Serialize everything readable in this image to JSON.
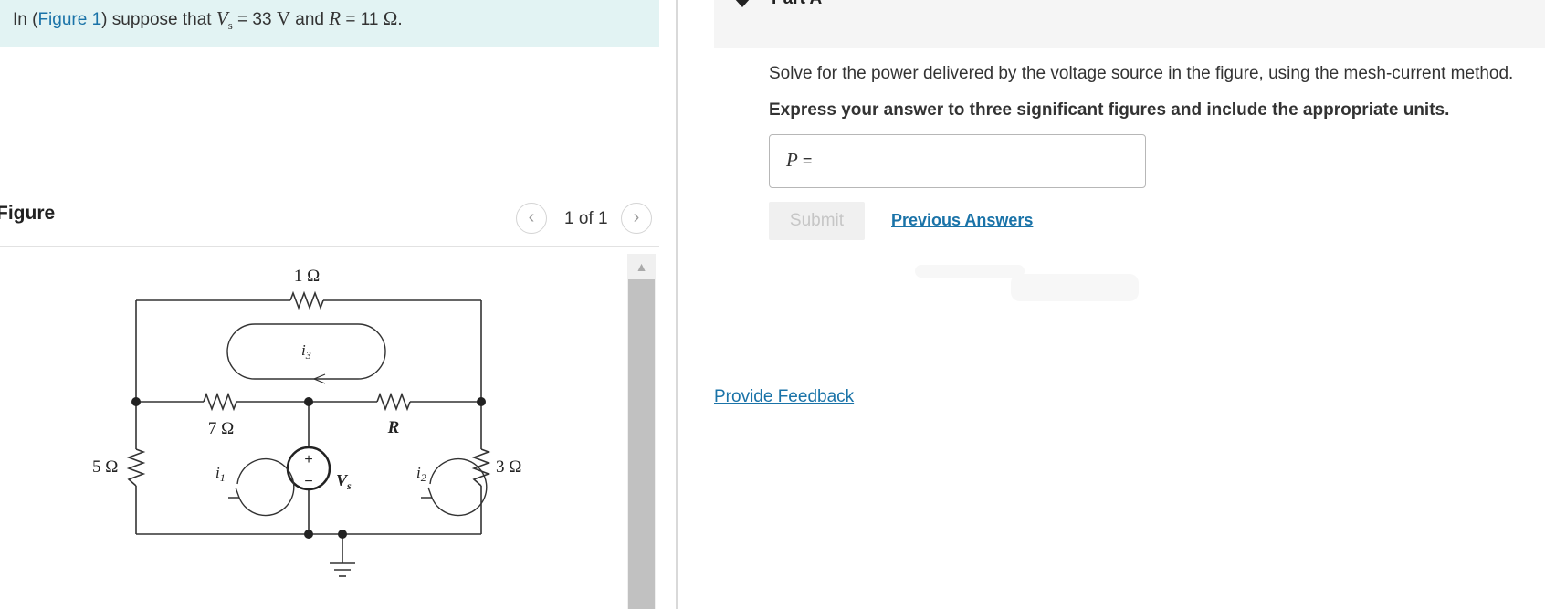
{
  "problem": {
    "prefix": "In (",
    "figure_link": "Figure 1",
    "middle": ") suppose that ",
    "vs_symbol": "V",
    "vs_sub": "s",
    "vs_eq": " = 33 ",
    "vs_unit": "V",
    "and_text": " and ",
    "r_symbol": "R",
    "r_eq": " = 11 ",
    "r_unit": "Ω",
    "end": "."
  },
  "figure": {
    "title": "Figure",
    "pager_count": "1 of 1",
    "prev_icon": "chevron-left-icon",
    "next_icon": "chevron-right-icon",
    "labels": {
      "r_top": "1 Ω",
      "r_left": "5 Ω",
      "r_mid": "7 Ω",
      "r_var": "R",
      "r_right": "3 Ω",
      "i3": "i",
      "i3_sub": "3",
      "i1": "i",
      "i1_sub": "1",
      "i2": "i",
      "i2_sub": "2",
      "vs": "V",
      "vs_sub": "s",
      "plus": "+",
      "minus": "−"
    }
  },
  "part": {
    "title": "Part A",
    "question": "Solve for the power delivered by the voltage source in the figure, using the mesh-current method.",
    "instruction": "Express your answer to three significant figures and include the appropriate units.",
    "answer_var": "P",
    "answer_eq": " =",
    "answer_value": "",
    "submit_label": "Submit",
    "previous_answers_label": "Previous Answers"
  },
  "feedback_label": "Provide Feedback",
  "colors": {
    "banner": "#e2f3f3",
    "link": "#1a73a8",
    "part_header": "#f5f5f5"
  }
}
